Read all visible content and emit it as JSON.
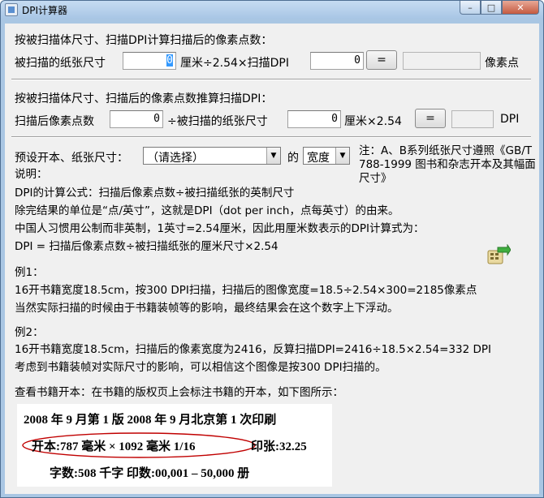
{
  "window": {
    "title": "DPI计算器",
    "min": "–",
    "max": "□",
    "close": "✕"
  },
  "section1": {
    "heading": "按被扫描体尺寸、扫描DPI计算扫描后的像素点数：",
    "label_size": "被扫描的纸张尺寸",
    "size_value": "0",
    "mid_text": "厘米÷2.54×扫描DPI",
    "dpi_value": "0",
    "equals": "=",
    "result_value": "",
    "unit": "像素点"
  },
  "section2": {
    "heading": "按被扫描体尺寸、扫描后的像素点数推算扫描DPI：",
    "label_pixels": "扫描后像素点数",
    "pixels_value": "0",
    "mid_text": "÷被扫描的纸张尺寸",
    "size_value": "0",
    "cm_text": "厘米×2.54",
    "equals": "=",
    "result_value": "",
    "unit": "DPI"
  },
  "preset": {
    "label": "预设开本、纸张尺寸：",
    "select_value": "（请选择）",
    "of": "的",
    "dim_value": "宽度",
    "note": "注：A、B系列纸张尺寸遵照《GB/T 788-1999 图书和杂志开本及其幅面尺寸》"
  },
  "explanation": {
    "title": "说明：",
    "lines": [
      "DPI的计算公式：扫描后像素点数÷被扫描纸张的英制尺寸",
      "除完结果的单位是“点/英寸”，这就是DPI（dot per inch，点每英寸）的由来。",
      "中国人习惯用公制而非英制，1英寸=2.54厘米，因此用厘米数表示的DPI计算式为：",
      "DPI = 扫描后像素点数÷被扫描纸张的厘米尺寸×2.54"
    ],
    "example1_title": "例1：",
    "example1_lines": [
      "16开书籍宽度18.5cm，按300 DPI扫描，扫描后的图像宽度=18.5÷2.54×300=2185像素点",
      "当然实际扫描的时候由于书籍装帧等的影响，最终结果会在这个数字上下浮动。"
    ],
    "example2_title": "例2：",
    "example2_lines": [
      "16开书籍宽度18.5cm，扫描后的像素宽度为2416，反算扫描DPI=2416÷18.5×2.54=332 DPI",
      "考虑到书籍装帧对实际尺寸的影响，可以相信这个图像是按300 DPI扫描的。"
    ],
    "view_text": "查看书籍开本：在书籍的版权页上会标注书籍的开本，如下图所示："
  },
  "copyright_image": {
    "line1": "2008 年 9 月第 1 版    2008 年 9 月北京第 1 次印刷",
    "line2_format": "开本:787 毫米 × 1092 毫米   1/16",
    "line2_sheets": "印张:32.25",
    "line3": "字数:508 千字   印数:00,001 – 50,000 册"
  },
  "colors": {
    "selection": "#3399ff",
    "oval": "#c00000",
    "client_bg": "#f0f0f0"
  }
}
